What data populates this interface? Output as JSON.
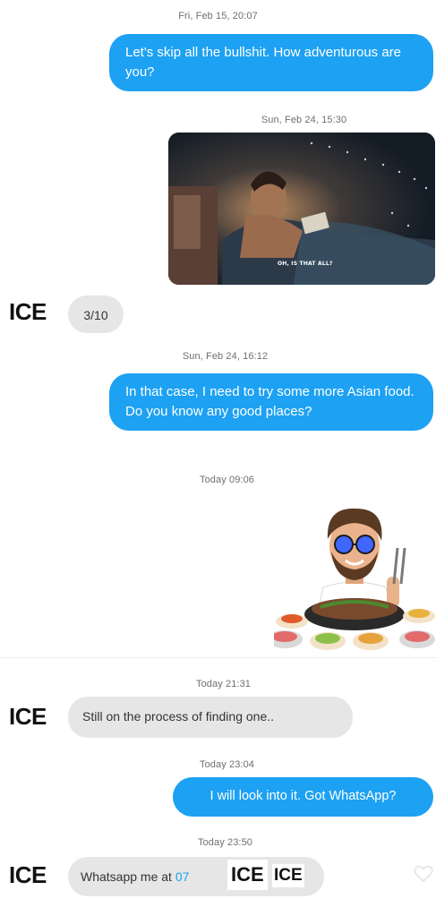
{
  "messages": {
    "ts1": "Fri, Feb 15, 20:07",
    "m1": "Let's skip all the bullshit. How adventurous are you?",
    "ts2": "Sun, Feb 24, 15:30",
    "gif_caption": "OH, IS THAT ALL?",
    "sender1": "ICE",
    "m2": "3/10",
    "ts3": "Sun, Feb 24, 16:12",
    "m3": "In that case, I need to try some more Asian food. Do you know any good places?",
    "ts4": "Today 09:06",
    "ts5": "Today 21:31",
    "sender2": "ICE",
    "m4": "Still on the process of finding one..",
    "ts6": "Today 23:04",
    "m5": "I will look into it. Got WhatsApp?",
    "ts7": "Today 23:50",
    "sender3": "ICE",
    "m6_prefix": "Whatsapp me at ",
    "m6_number": "07",
    "redact1": "ICE",
    "redact2": "ICE"
  },
  "colors": {
    "outgoing": "#1da1f2",
    "incoming": "#e6e6e6",
    "link": "#1da1f2"
  }
}
